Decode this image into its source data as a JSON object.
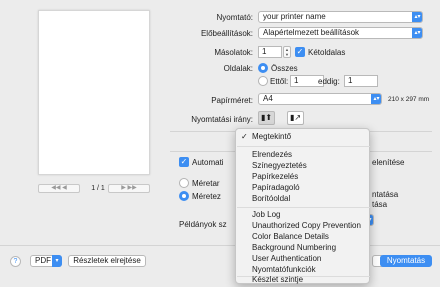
{
  "preview": {
    "page_indicator": "1 / 1",
    "prev_label": "◀◀  ◀",
    "next_label": "▶  ▶▶"
  },
  "printer": {
    "label": "Nyomtató:",
    "value": "your printer name"
  },
  "presets": {
    "label": "Előbeállítások:",
    "value": "Alapértelmezett beállítások"
  },
  "copies": {
    "label": "Másolatok:",
    "value": "1",
    "two_sided_label": "Kétoldalas",
    "two_sided_checked": true
  },
  "pages": {
    "label": "Oldalak:",
    "all_label": "Összes",
    "from_label": "Ettől:",
    "from_value": "1",
    "to_label": "eddig:",
    "to_value": "1"
  },
  "paper": {
    "label": "Papírméret:",
    "value": "A4",
    "dimensions": "210 x 297 mm"
  },
  "orientation": {
    "label": "Nyomtatási irány:"
  },
  "obscured": {
    "automatic_label": "Automati",
    "right_fragment": "elenítése",
    "scale1_label": "Méretar",
    "scale2_label": "Méretez",
    "print_fragment": "ntatása",
    "pages_fragment": "tása",
    "pages_per_sheet_label": "Példányok sz"
  },
  "menu": {
    "checked_mark": "✓",
    "items": [
      "Megtekintő",
      "Elrendezés",
      "Színegyeztetés",
      "Papírkezelés",
      "Papíradagoló",
      "Borítóoldal",
      "Job Log",
      "Unauthorized Copy Prevention",
      "Color Balance Details",
      "Background Numbering",
      "User Authentication",
      "Nyomtatófunkciók",
      "Készlet szintje"
    ]
  },
  "footer": {
    "help_label": "?",
    "pdf_label": "PDF",
    "details_label": "Részletek elrejtése",
    "print_label": "Nyomtatás"
  },
  "colors": {
    "accent": "#3d8ef2"
  }
}
